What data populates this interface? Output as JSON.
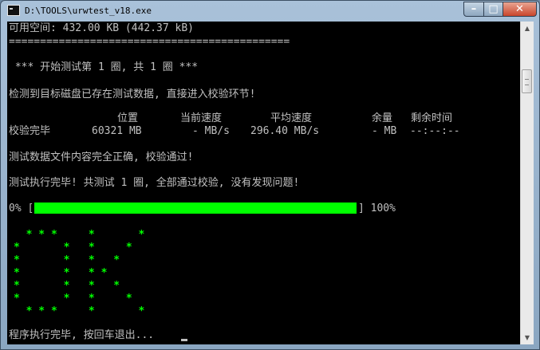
{
  "window": {
    "title": "D:\\TOOLS\\urwtest_v18.exe",
    "controls": {
      "minimize": "–",
      "maximize": "□",
      "close": "✕"
    }
  },
  "console": {
    "free_space": "可用空间: 432.00 KB (442.37 kB)",
    "separator": "=============================================",
    "round_header": " *** 开始测试第 1 圈, 共 1 圈 ***",
    "detected_msg": "检测到目标磁盘已存在测试数据, 直接进入校验环节!",
    "table": {
      "headers": [
        "位置",
        "当前速度",
        "平均速度",
        "余量",
        "剩余时间"
      ],
      "row": {
        "status": "校验完毕",
        "position": "60321 MB",
        "current_speed": "- MB/s",
        "avg_speed": "296.40 MB/s",
        "remaining": "- MB",
        "time_left": "--:--:--"
      }
    },
    "verify_ok": "测试数据文件内容完全正确, 校验通过!",
    "done_msg": "测试执行完毕! 共测试 1 圈, 全部通过校验, 没有发现问题!",
    "progress": {
      "start_label": "0% [",
      "end_label": "] 100%",
      "percent": 100,
      "color": "#00ff00"
    },
    "ok_art": [
      "  * * *     *       *",
      "*       *   *     *",
      "*       *   *   *",
      "*       *   * *",
      "*       *   *   *",
      "*       *   *     *",
      "  * * *     *       *"
    ],
    "exit_prompt": "程序执行完毕, 按回车退出..."
  },
  "scrollbar": {
    "up_icon": "▲",
    "down_icon": "▼"
  },
  "colors": {
    "console_bg": "#000000",
    "console_text": "#c0c0c0",
    "accent_green": "#00ff00"
  }
}
